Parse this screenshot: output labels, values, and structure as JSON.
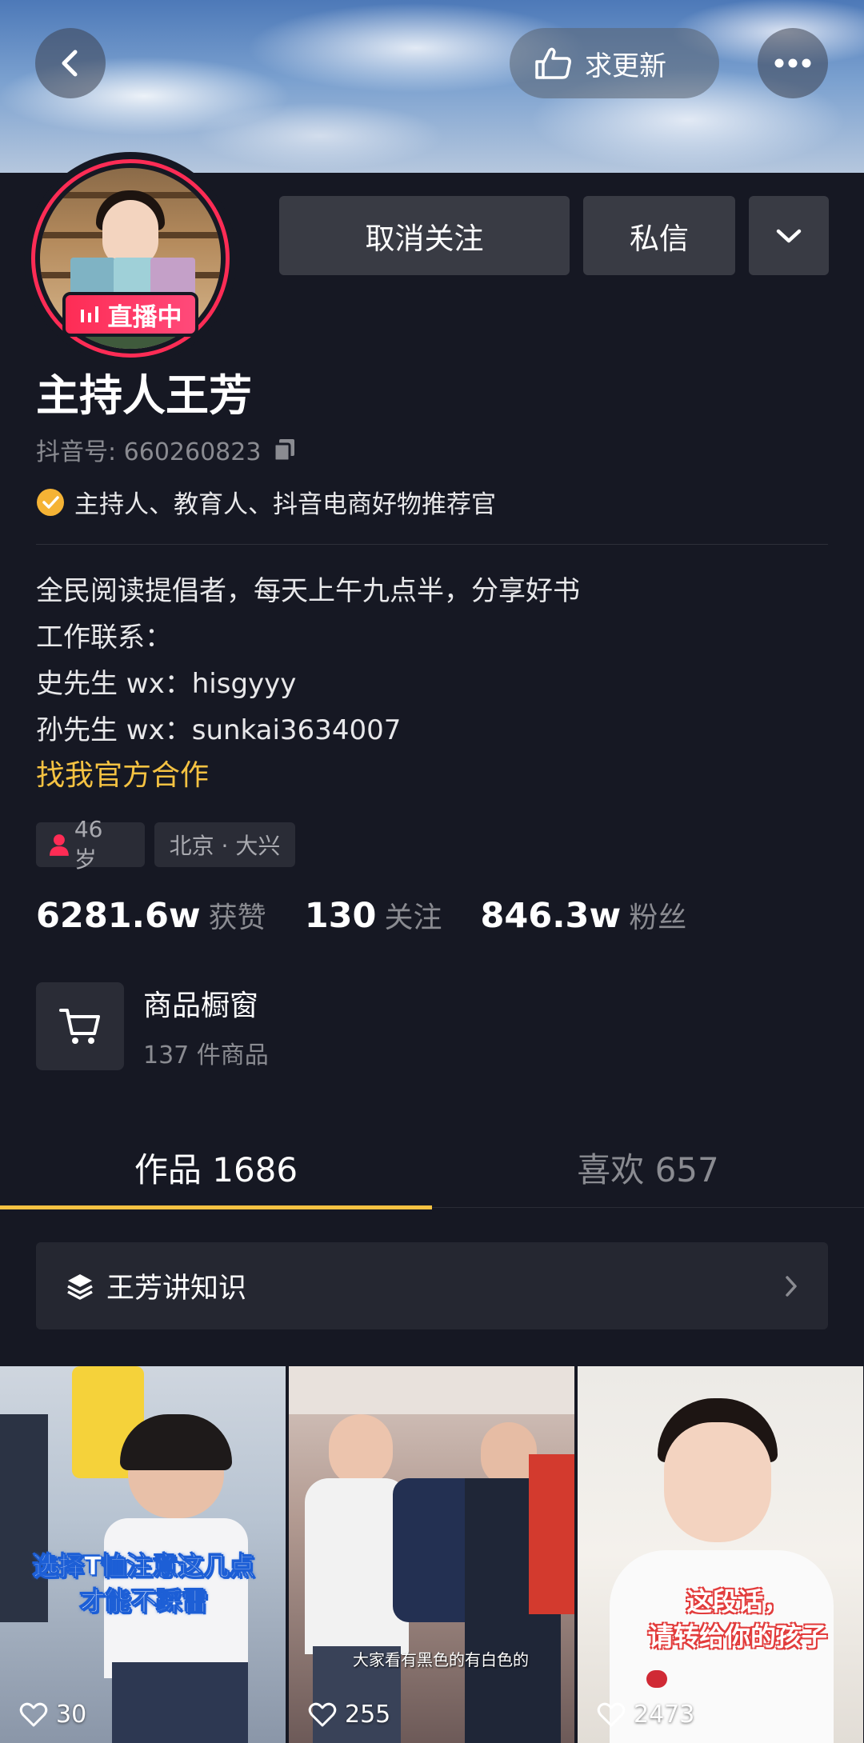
{
  "header": {
    "update_label": "求更新"
  },
  "profile": {
    "live_label": "直播中",
    "name": "主持人王芳",
    "douyin_id": "抖音号: 660260823",
    "verified_text": "主持人、教育人、抖音电商好物推荐官",
    "bio": [
      "全民阅读提倡者，每天上午九点半，分享好书",
      "工作联系：",
      "史先生 wx：hisgyyy",
      "孙先生 wx：sunkai3634007"
    ],
    "collab_link": "找我官方合作",
    "tags": {
      "age": "46 岁",
      "location": "北京 · 大兴"
    },
    "accent_color": "#fe2c55",
    "gold_color": "#f5c242"
  },
  "actions": {
    "unfollow": "取消关注",
    "message": "私信"
  },
  "stats": [
    {
      "num": "6281.6w",
      "label": "获赞"
    },
    {
      "num": "130",
      "label": "关注"
    },
    {
      "num": "846.3w",
      "label": "粉丝"
    }
  ],
  "shop": {
    "title": "商品橱窗",
    "subtitle": "137 件商品"
  },
  "tabs": {
    "works": "作品 1686",
    "likes": "喜欢 657"
  },
  "collection": {
    "title": "王芳讲知识"
  },
  "videos": [
    {
      "caption_line1": "选择T恤注意这几点",
      "caption_line2": "才能不踩雷",
      "likes": "30"
    },
    {
      "caption": "大家看有黑色的有白色的",
      "likes": "255"
    },
    {
      "caption_line1": "这段话，",
      "caption_line2": "请转给你的孩子",
      "likes": "2473"
    }
  ]
}
